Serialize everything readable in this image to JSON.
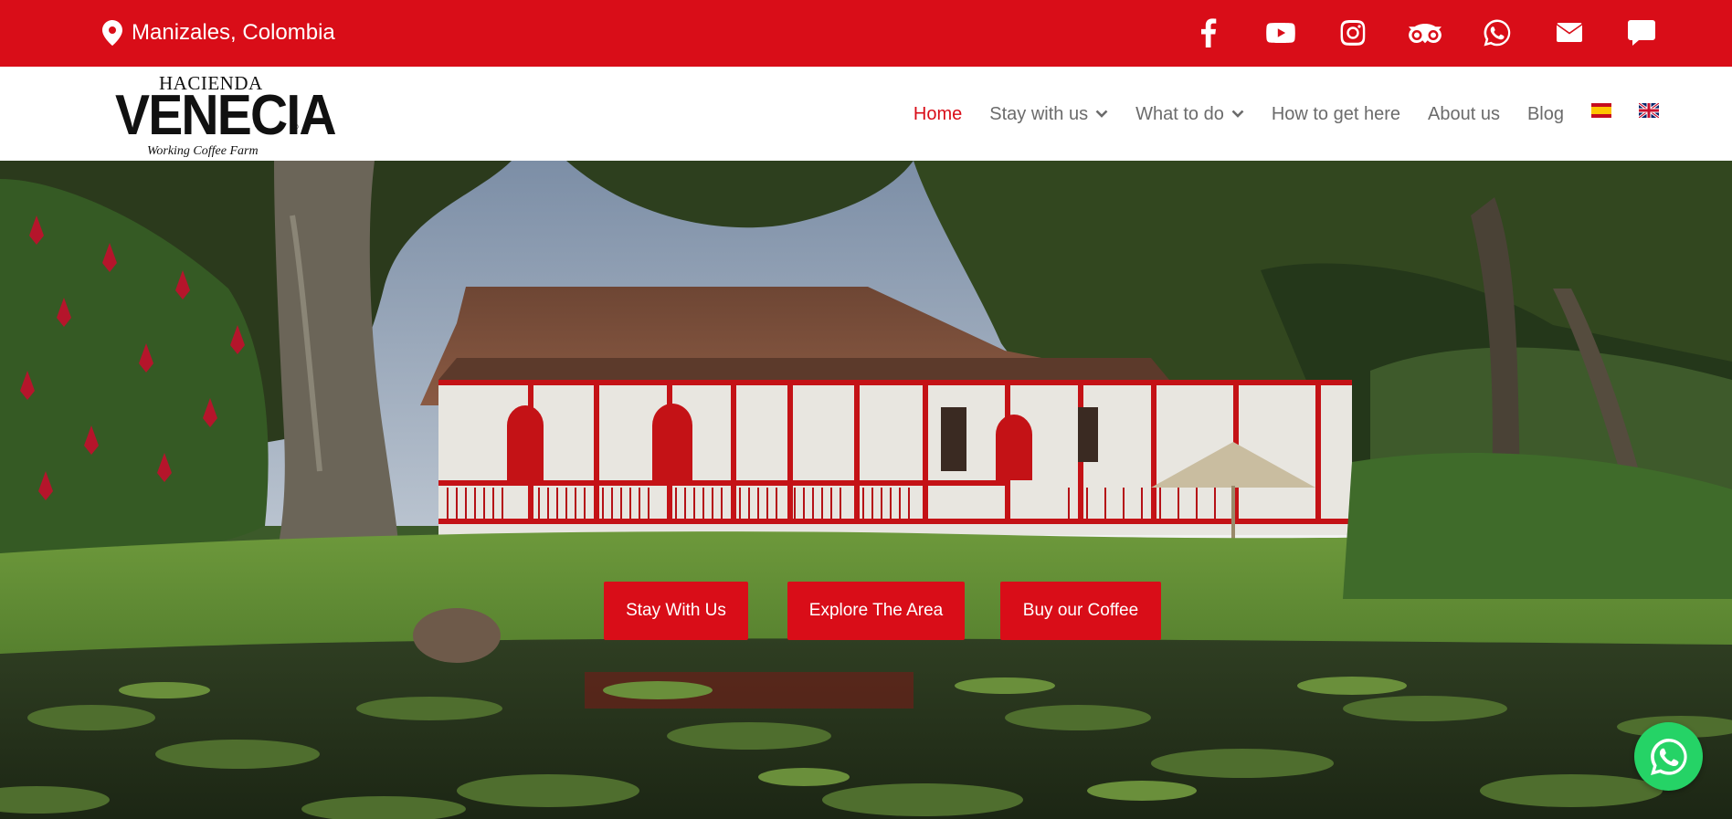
{
  "topbar": {
    "location": "Manizales, Colombia",
    "location_icon": "map-pin-icon",
    "background": "#d90d18",
    "socials": [
      "facebook-icon",
      "youtube-icon",
      "instagram-icon",
      "tripadvisor-icon",
      "whatsapp-icon",
      "envelope-icon",
      "chat-icon"
    ]
  },
  "logo": {
    "line1": "HACIENDA",
    "line2": "VENECIA",
    "line3": "Working Coffee Farm",
    "reg": "®"
  },
  "nav": {
    "items": [
      {
        "label": "Home",
        "active": true
      },
      {
        "label": "Stay with us",
        "dropdown": true
      },
      {
        "label": "What to do",
        "dropdown": true
      },
      {
        "label": "How to get here"
      },
      {
        "label": "About us"
      },
      {
        "label": "Blog"
      }
    ],
    "flags": [
      "spanish-flag-icon",
      "english-flag-icon"
    ],
    "active_color": "#d90d18",
    "text_color": "#6b6b6b"
  },
  "hero": {
    "buttons": [
      "Stay With Us",
      "Explore The Area",
      "Buy our Coffee"
    ],
    "button_color": "#d90d18"
  },
  "floating": {
    "whatsapp_icon": "whatsapp-icon",
    "color": "#25d366"
  }
}
